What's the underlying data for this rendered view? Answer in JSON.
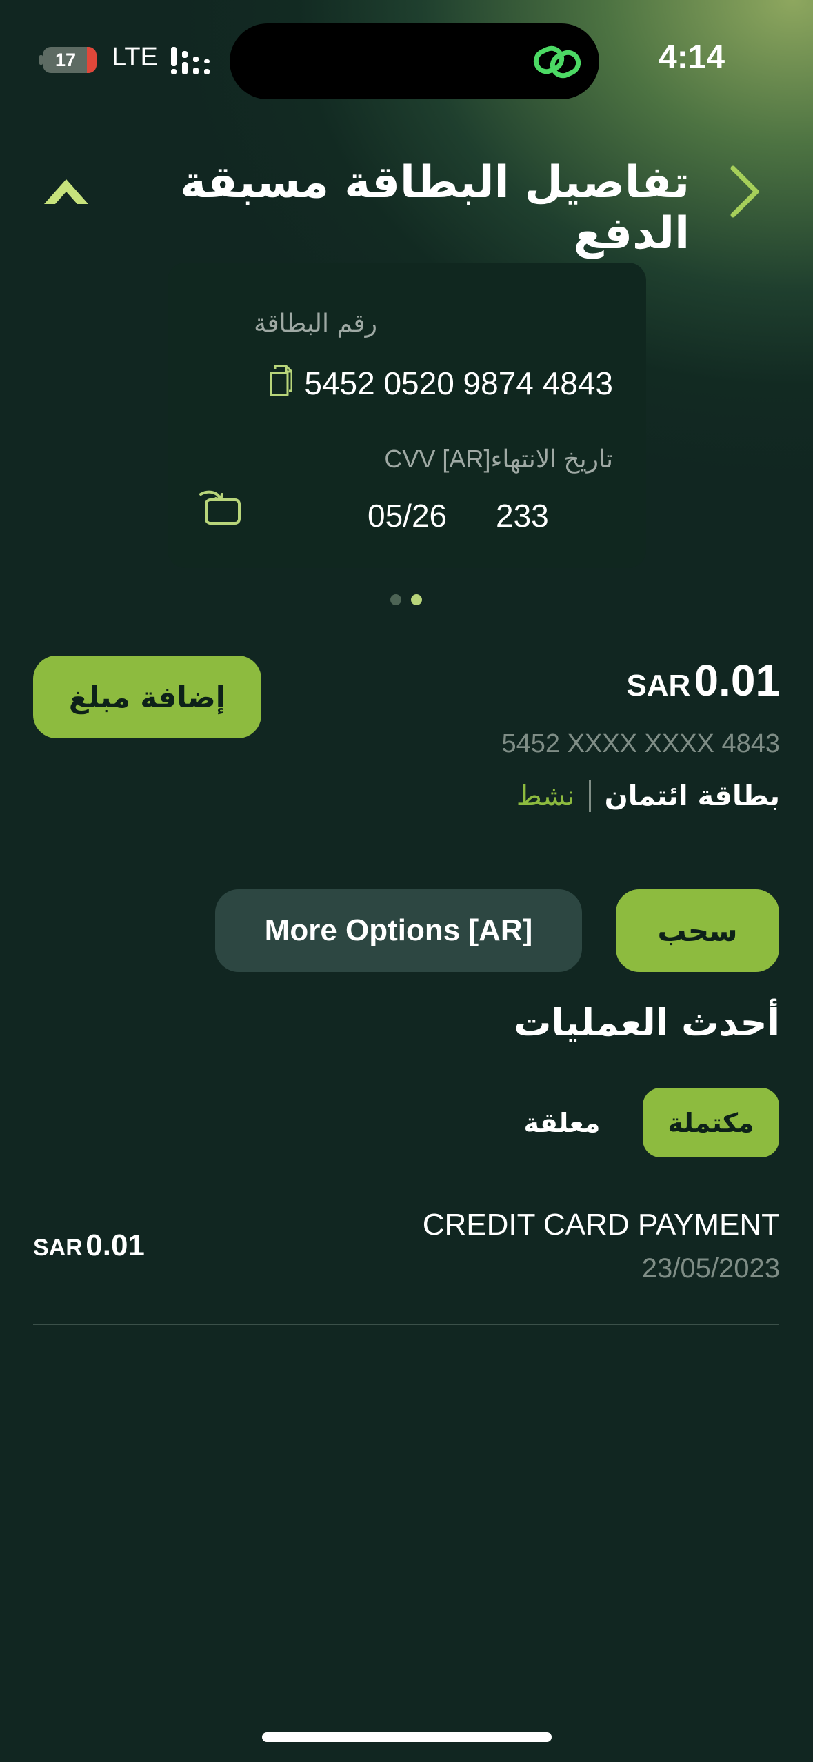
{
  "status_bar": {
    "battery": "17",
    "network": "LTE",
    "time": "4:14"
  },
  "header": {
    "title": "تفاصيل البطاقة مسبقة الدفع"
  },
  "card": {
    "number_label": "رقم البطاقة",
    "number": "5452 0520 9874 4843",
    "expiry_cvv_label": "CVV [AR]تاريخ الانتهاء",
    "expiry": "05/26",
    "cvv": "233",
    "page_indicator": {
      "total": 2,
      "active": 2
    }
  },
  "balance": {
    "currency": "SAR",
    "amount": "0.01",
    "masked_number": "5452 XXXX XXXX 4843",
    "card_type": "بطاقة ائتمان",
    "status": "نشط",
    "add_funds_label": "إضافة مبلغ"
  },
  "actions": {
    "withdraw_label": "سحب",
    "more_options_label": "More Options [AR]"
  },
  "transactions": {
    "title": "أحدث العمليات",
    "tabs": [
      {
        "label": "مكتملة",
        "active": true
      },
      {
        "label": "معلقة",
        "active": false
      }
    ],
    "items": [
      {
        "name": "CREDIT CARD PAYMENT",
        "date": "23/05/2023",
        "currency": "SAR",
        "amount": "0.01"
      }
    ]
  },
  "colors": {
    "accent": "#8dbb3f",
    "background": "#112621",
    "card": "#10271f",
    "secondary_button": "#2d4742"
  }
}
